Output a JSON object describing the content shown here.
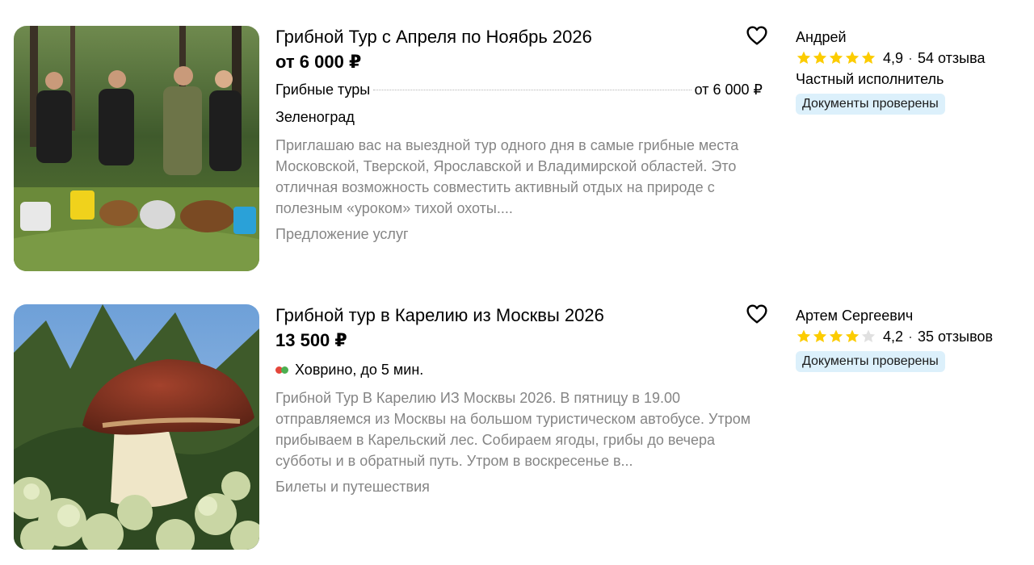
{
  "colors": {
    "star": "#fccc00",
    "star_empty": "#e0e0e0",
    "badge_bg": "#dcf0fb",
    "muted_text": "#858585"
  },
  "listings": [
    {
      "title": "Грибной Тур с Апреля по Ноябрь 2026",
      "price": "от 6 000 ₽",
      "param_label": "Грибные туры",
      "param_value": "от 6 000 ₽",
      "city": "Зеленоград",
      "description": "Приглашаю вас на выездной тур одного дня в самые грибные места Московской, Тверской, Ярославской и Владимирской областей. Это отличная возможность совместить активный отдых на природе с полезным «уроком» тихой охоты....",
      "category": "Предложение услуг",
      "favorite_icon": "heart-outline-icon",
      "seller": {
        "name": "Андрей",
        "rating": "4,9",
        "rating_value": 4.9,
        "reviews": "54 отзыва",
        "type": "Частный исполнитель",
        "badge": "Документы проверены"
      }
    },
    {
      "title": "Грибной тур в Карелию из Москвы 2026",
      "price": "13 500 ₽",
      "metro": "Ховрино, до 5 мин.",
      "metro_colors": [
        "#e4463a",
        "#4caf50"
      ],
      "description": "Грибной Тур В Карелию ИЗ Москвы 2026. В пятницу в 19.00 отправляемся из Москвы на большом туристическом автобусе. Утром прибываем в Карельский лес. Собираем ягоды, грибы до вечера субботы и в обратный путь. Утром в воскресенье в...",
      "category": "Билеты и путешествия",
      "favorite_icon": "heart-outline-icon",
      "seller": {
        "name": "Артем Сергеевич",
        "rating": "4,2",
        "rating_value": 4.2,
        "reviews": "35 отзывов",
        "badge": "Документы проверены"
      }
    }
  ]
}
